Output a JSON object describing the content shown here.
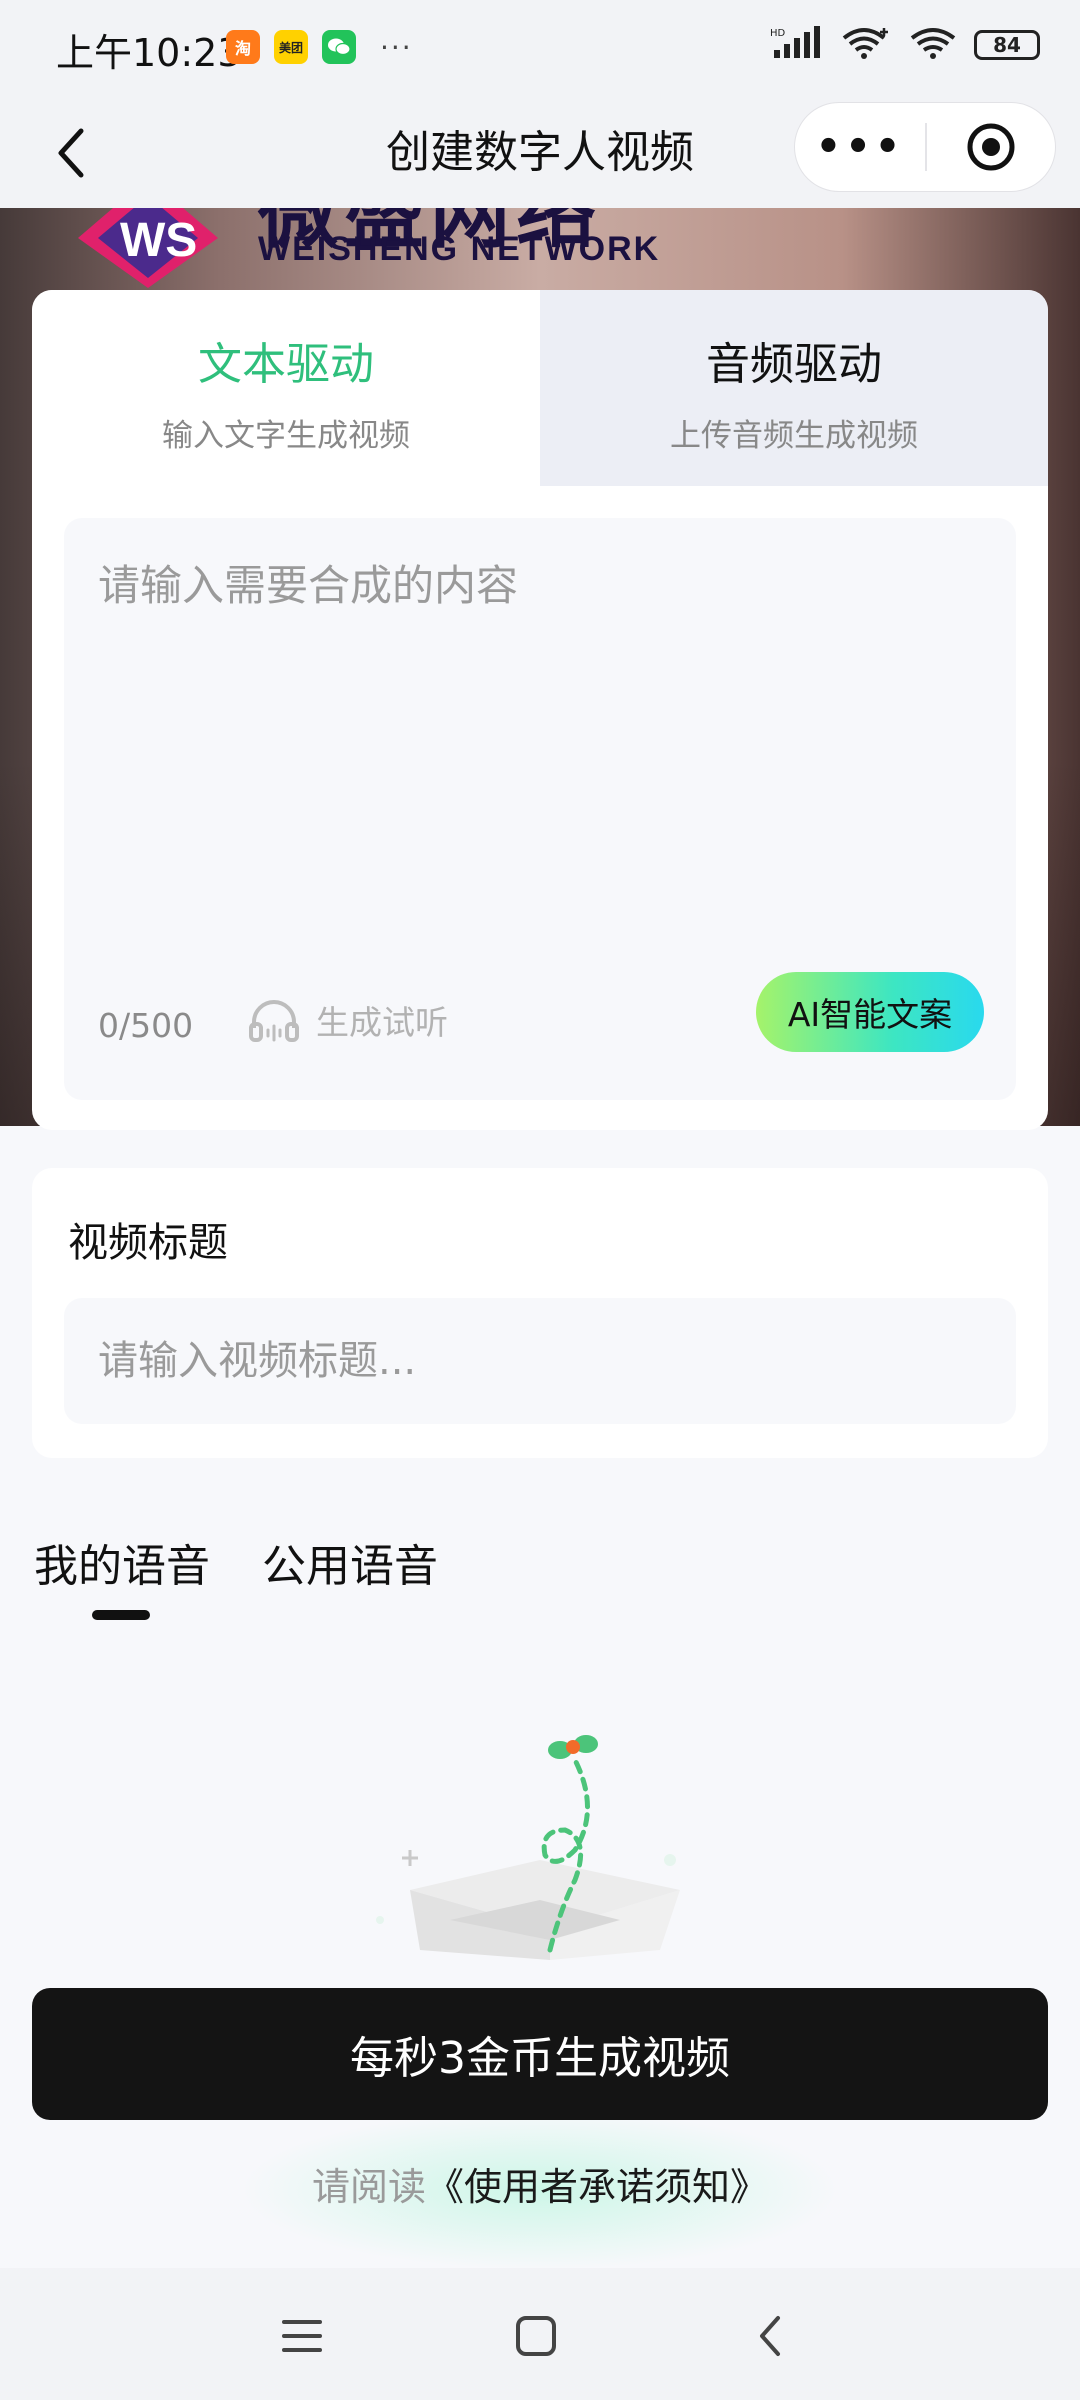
{
  "status_bar": {
    "time": "上午10:23",
    "app_icons": [
      "taobao-icon",
      "meituan-icon",
      "wechat-icon"
    ],
    "meituan_label": "美团",
    "taobao_label": "淘",
    "more": "···",
    "signal_label": "HD",
    "battery": "84"
  },
  "nav": {
    "title": "创建数字人视频",
    "more_label": "•••"
  },
  "hero": {
    "logo_cn": "微盛网络",
    "logo_en": "WEISHENG NETWORK"
  },
  "drive_tabs": [
    {
      "title": "文本驱动",
      "subtitle": "输入文字生成视频",
      "active": true
    },
    {
      "title": "音频驱动",
      "subtitle": "上传音频生成视频",
      "active": false
    }
  ],
  "text_input": {
    "placeholder": "请输入需要合成的内容",
    "value": "",
    "counter": "0/500",
    "listen_label": "生成试听",
    "ai_button": "AI智能文案"
  },
  "video_title": {
    "label": "视频标题",
    "placeholder": "请输入视频标题..."
  },
  "voice_tabs": [
    {
      "label": "我的语音",
      "active": true
    },
    {
      "label": "公用语音",
      "active": false
    }
  ],
  "primary_button": "每秒3金币生成视频",
  "agreement": {
    "prefix": "请阅读",
    "link": "《使用者承诺须知》"
  },
  "colors": {
    "accent_green": "#2fbf7c",
    "button_dark": "#141414",
    "page_bg": "#f7f8fb"
  }
}
